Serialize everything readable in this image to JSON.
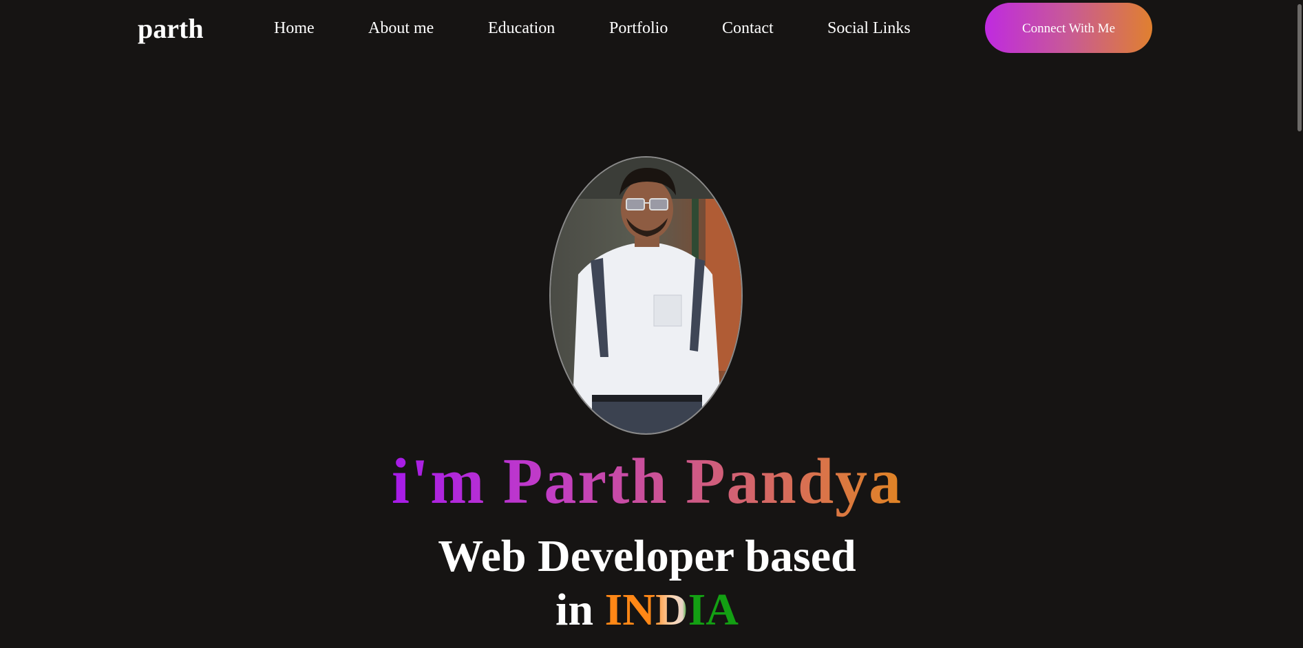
{
  "brand": {
    "logo": "parth"
  },
  "nav": {
    "items": [
      {
        "label": "Home"
      },
      {
        "label": "About me"
      },
      {
        "label": "Education"
      },
      {
        "label": "Portfolio"
      },
      {
        "label": "Contact"
      },
      {
        "label": "Social Links"
      }
    ],
    "cta_label": "Connect With Me"
  },
  "hero": {
    "greeting": "i'm Parth Pandya",
    "tagline_line1": "Web Developer based",
    "tagline_prefix": "in",
    "tagline_country": "INDIA"
  },
  "colors": {
    "background": "#161413",
    "accent_purple": "#bf2ae0",
    "accent_orange": "#e0802f",
    "india_saffron": "#ff8716",
    "india_green": "#13a013"
  }
}
